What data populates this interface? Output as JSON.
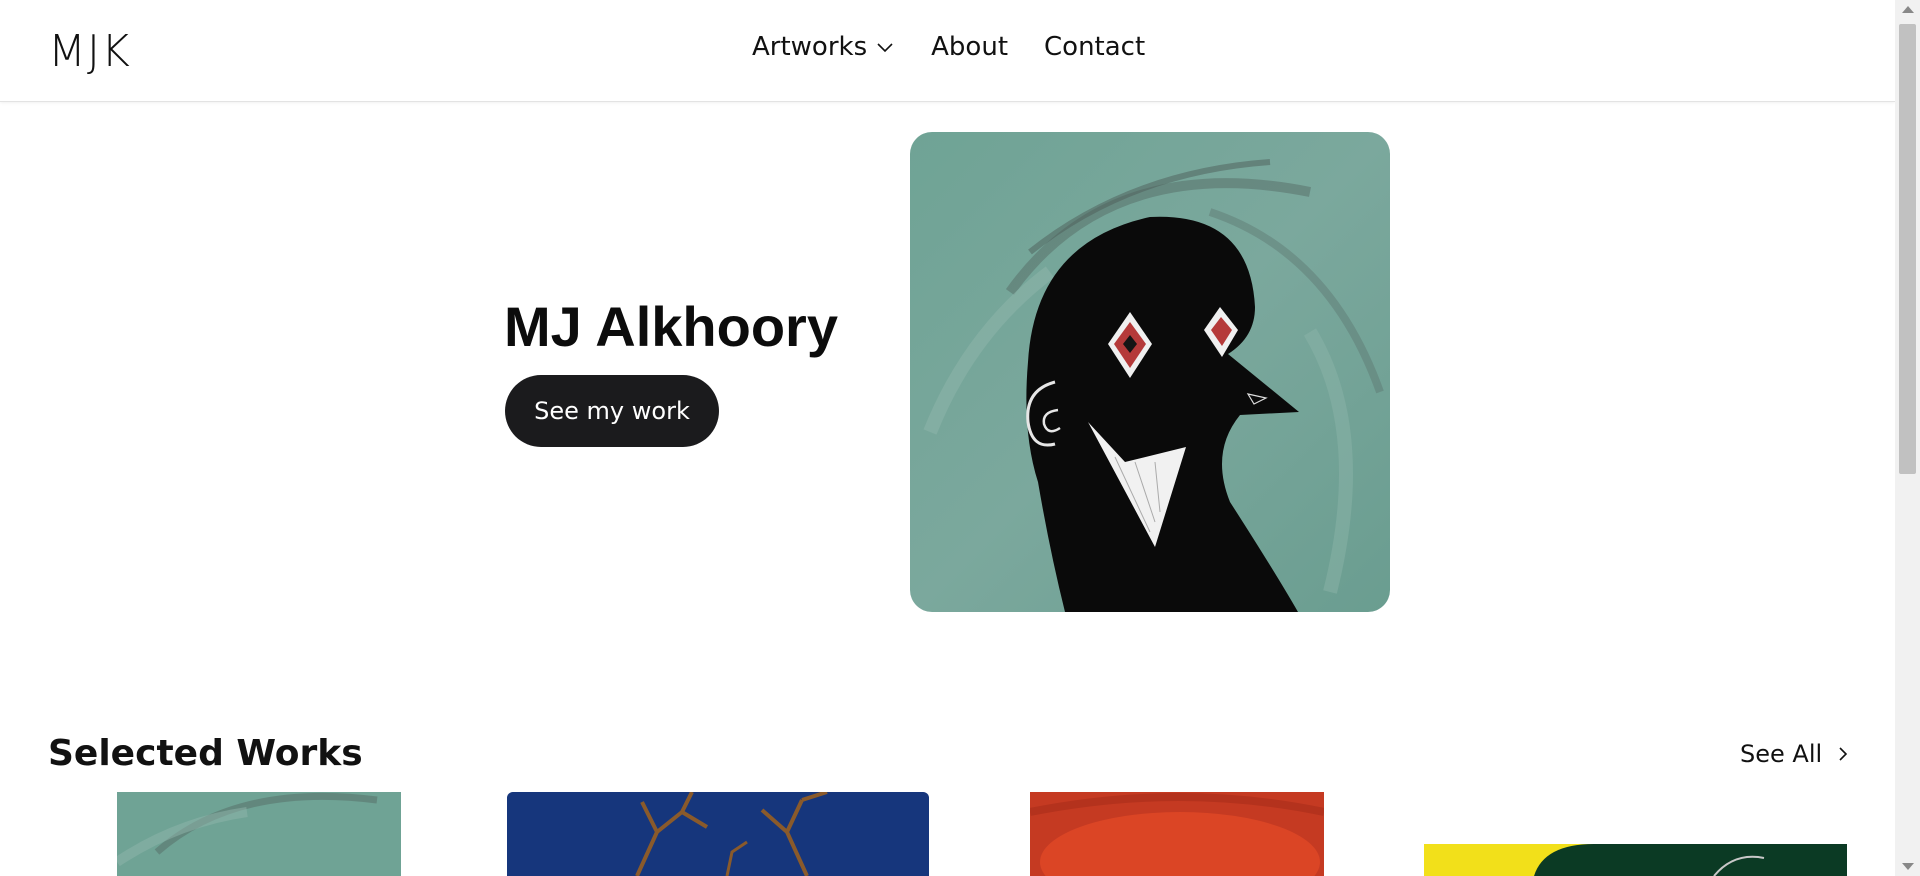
{
  "header": {
    "logo": "MJK",
    "nav": [
      {
        "label": "Artworks",
        "has_dropdown": true
      },
      {
        "label": "About"
      },
      {
        "label": "Contact"
      }
    ]
  },
  "hero": {
    "title": "MJ Alkhoory",
    "button_label": "See my work",
    "image": "painting of black silhouette bird-like figure on teal background"
  },
  "selected_works": {
    "title": "Selected Works",
    "see_all_label": "See All",
    "thumbnails": [
      "teal painting thumbnail",
      "blue painting with orange branches thumbnail",
      "red painting thumbnail",
      "yellow and green painting thumbnail"
    ]
  },
  "colors": {
    "button_bg": "#1b1b1d",
    "teal_art": "#6f9e93",
    "background": "#ffffff"
  }
}
